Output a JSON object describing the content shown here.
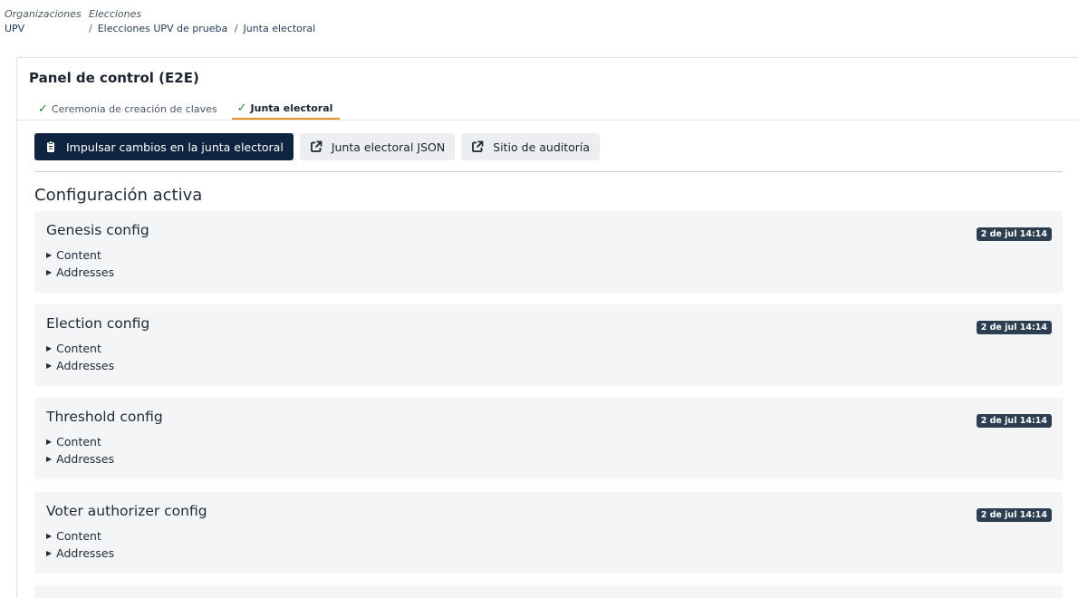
{
  "breadcrumb": {
    "organizations": {
      "caption": "Organizaciones",
      "value": "UPV"
    },
    "elections": {
      "caption": "Elecciones",
      "election": "Elecciones UPV de prueba",
      "current": "Junta electoral"
    },
    "separator": "/"
  },
  "panel": {
    "title": "Panel de control (E2E)",
    "tabs": [
      {
        "label": "Ceremonia de creación de claves",
        "icon": "check-icon",
        "active": false
      },
      {
        "label": "Junta electoral",
        "icon": "check-icon",
        "active": true
      }
    ]
  },
  "toolbar": {
    "push_label": "Impulsar cambios en la junta electoral",
    "push_icon": "clipboard-icon",
    "json_label": "Junta electoral JSON",
    "json_icon": "external-link-icon",
    "audit_label": "Sitio de auditoría",
    "audit_icon": "external-link-icon"
  },
  "section": {
    "title": "Configuración activa"
  },
  "configs": [
    {
      "title": "Genesis config",
      "date": "2 de jul 14:14",
      "content_label": "Content",
      "addresses_label": "Addresses"
    },
    {
      "title": "Election config",
      "date": "2 de jul 14:14",
      "content_label": "Content",
      "addresses_label": "Addresses"
    },
    {
      "title": "Threshold config",
      "date": "2 de jul 14:14",
      "content_label": "Content",
      "addresses_label": "Addresses"
    },
    {
      "title": "Voter authorizer config",
      "date": "2 de jul 14:14",
      "content_label": "Content",
      "addresses_label": "Addresses"
    }
  ],
  "colors": {
    "primary": "#0f2440",
    "tab_accent": "#e8922a",
    "check": "#1d8a3f",
    "badge": "#2c3e50",
    "card_bg": "#f4f5f7"
  }
}
